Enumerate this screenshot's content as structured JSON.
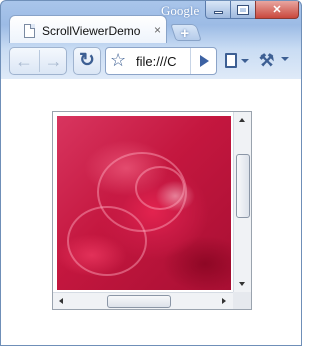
{
  "window": {
    "brand": "Google"
  },
  "tab": {
    "title": "ScrollViewerDemo",
    "close_label": "×",
    "new_tab_label": "+"
  },
  "toolbar": {
    "back_label": "←",
    "forward_label": "→",
    "reload_label": "↻",
    "star_label": "☆",
    "url": "file:///C",
    "tools_label": "🔧"
  },
  "scrollviewer": {
    "vertical_scroll_position": 0.25,
    "horizontal_scroll_position": 0.5
  },
  "icons": {
    "page": "page-icon",
    "wrench": "wrench-icon",
    "star": "star-icon",
    "go": "go-arrow-icon"
  },
  "colors": {
    "frame_accent": "#9cbbe5",
    "rose_red": "#d8355f",
    "icon_blue": "#3d5f93"
  }
}
